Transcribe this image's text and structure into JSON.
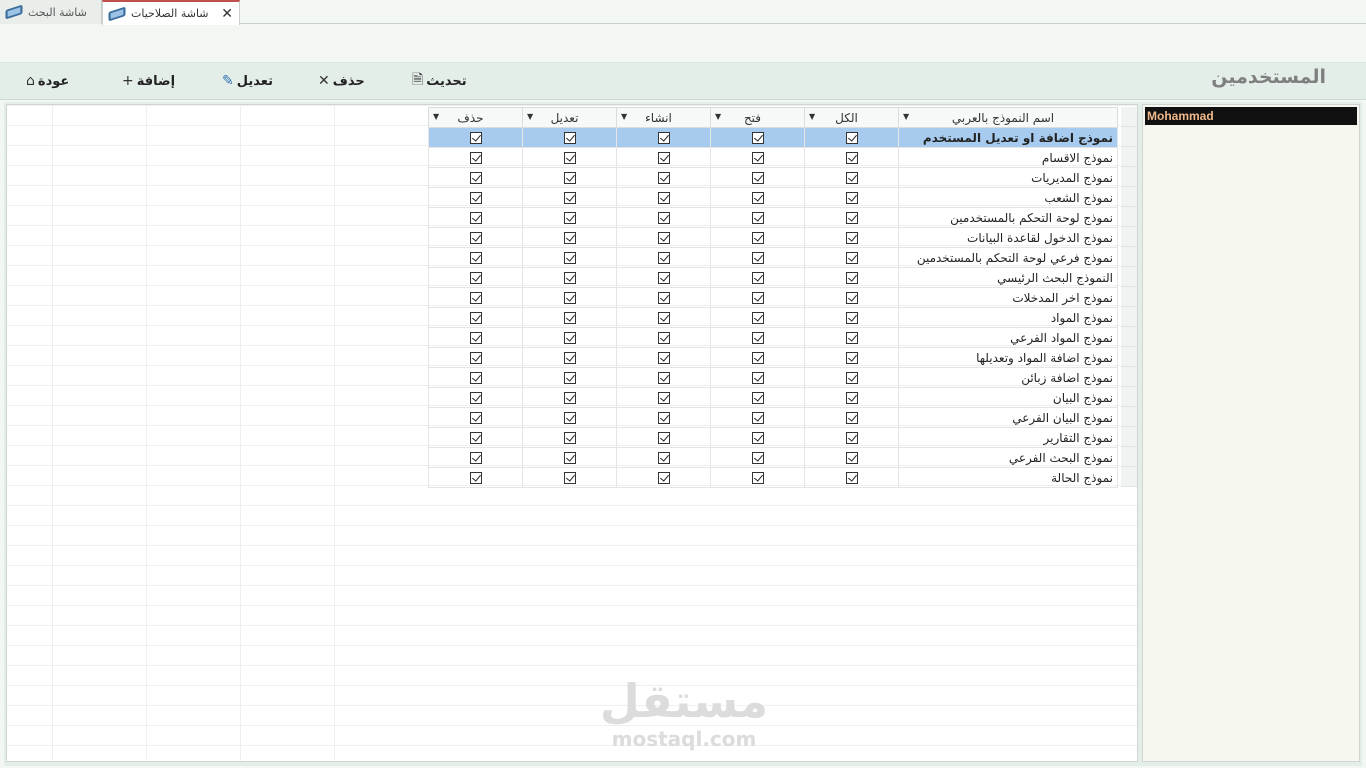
{
  "tabs": [
    {
      "label": "شاشة البحث",
      "active": false
    },
    {
      "label": "شاشة الصلاحيات",
      "active": true
    }
  ],
  "toolbar": {
    "back": "عودة",
    "add": "إضافة",
    "edit": "تعديل",
    "delete": "حذف",
    "refresh": "تحديث"
  },
  "title": "المستخدمين",
  "columns": {
    "name": "اسم النموذج بالعربي",
    "all": "الكل",
    "open": "فتح",
    "create": "انشاء",
    "edit": "تعديل",
    "delete": "حذف"
  },
  "rows": [
    "نموذج اضافة او تعديل المستخدم",
    "نموذج الاقسام",
    "نموذج المديريات",
    "نموذج الشعب",
    "نموذج لوحة التحكم بالمستخدمين",
    "نموذج الدخول لقاعدة البيانات",
    "نموذج فرعي لوحة التحكم بالمستخدمين",
    "النموذج البحث الرئيسي",
    "نموذج اخر المدخلات",
    "نموذج المواد",
    "نموذج المواد الفرعي",
    "نموذج اضافة المواد وتعديلها",
    "نموذج اضافة زبائن",
    "نموذج البيان",
    "نموذج البيان الفرعي",
    "نموذج التقارير",
    "نموذج البحث الفرعي",
    "نموذج الحالة"
  ],
  "selected_row": 0,
  "users": [
    "Mohammad"
  ],
  "watermark": {
    "ar": "مستقل",
    "en": "mostaql.com"
  },
  "colors": {
    "accent": "#c0504d",
    "selection": "#a6cbee",
    "user_bg": "#111111",
    "user_fg": "#f0b98a"
  }
}
